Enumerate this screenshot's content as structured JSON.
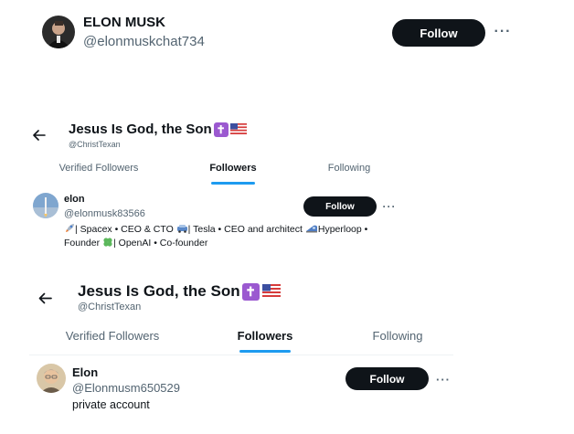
{
  "card1": {
    "name": "ELON MUSK",
    "handle": "@elonmuskchat734",
    "follow_label": "Follow",
    "more_label": "···"
  },
  "panel1": {
    "back_label": "←",
    "title": "Jesus Is God, the Son",
    "handle": "@ChristTexan",
    "tabs": [
      "Verified Followers",
      "Followers",
      "Following"
    ],
    "active_tab": "Followers",
    "user": {
      "name": "elon",
      "handle": "@elonmusk83566",
      "follow_label": "Follow",
      "more_label": "···",
      "bio_line1_a": "| Spacex • CEO & CTO",
      "bio_line1_b": "| Tesla • CEO and architect",
      "bio_line1_c": "Hyperloop •",
      "bio_line2_a": "Founder",
      "bio_line2_b": "| OpenAI • Co-founder"
    }
  },
  "panel2": {
    "back_label": "←",
    "title": "Jesus Is God, the Son",
    "handle": "@ChristTexan",
    "tabs": [
      "Verified Followers",
      "Followers",
      "Following"
    ],
    "active_tab": "Followers",
    "user": {
      "name": "Elon",
      "handle": "@Elonmusm650529",
      "bio": "private account",
      "follow_label": "Follow",
      "more_label": "···"
    }
  },
  "colors": {
    "accent": "#1d9bf0",
    "button_bg": "#0f1419",
    "secondary_text": "#536471",
    "cross_badge": "#9b59d0"
  },
  "icons": [
    "back-arrow-icon",
    "cross-icon",
    "us-flag-icon",
    "rocket-icon",
    "car-icon",
    "train-icon",
    "clover-icon",
    "more-icon"
  ]
}
